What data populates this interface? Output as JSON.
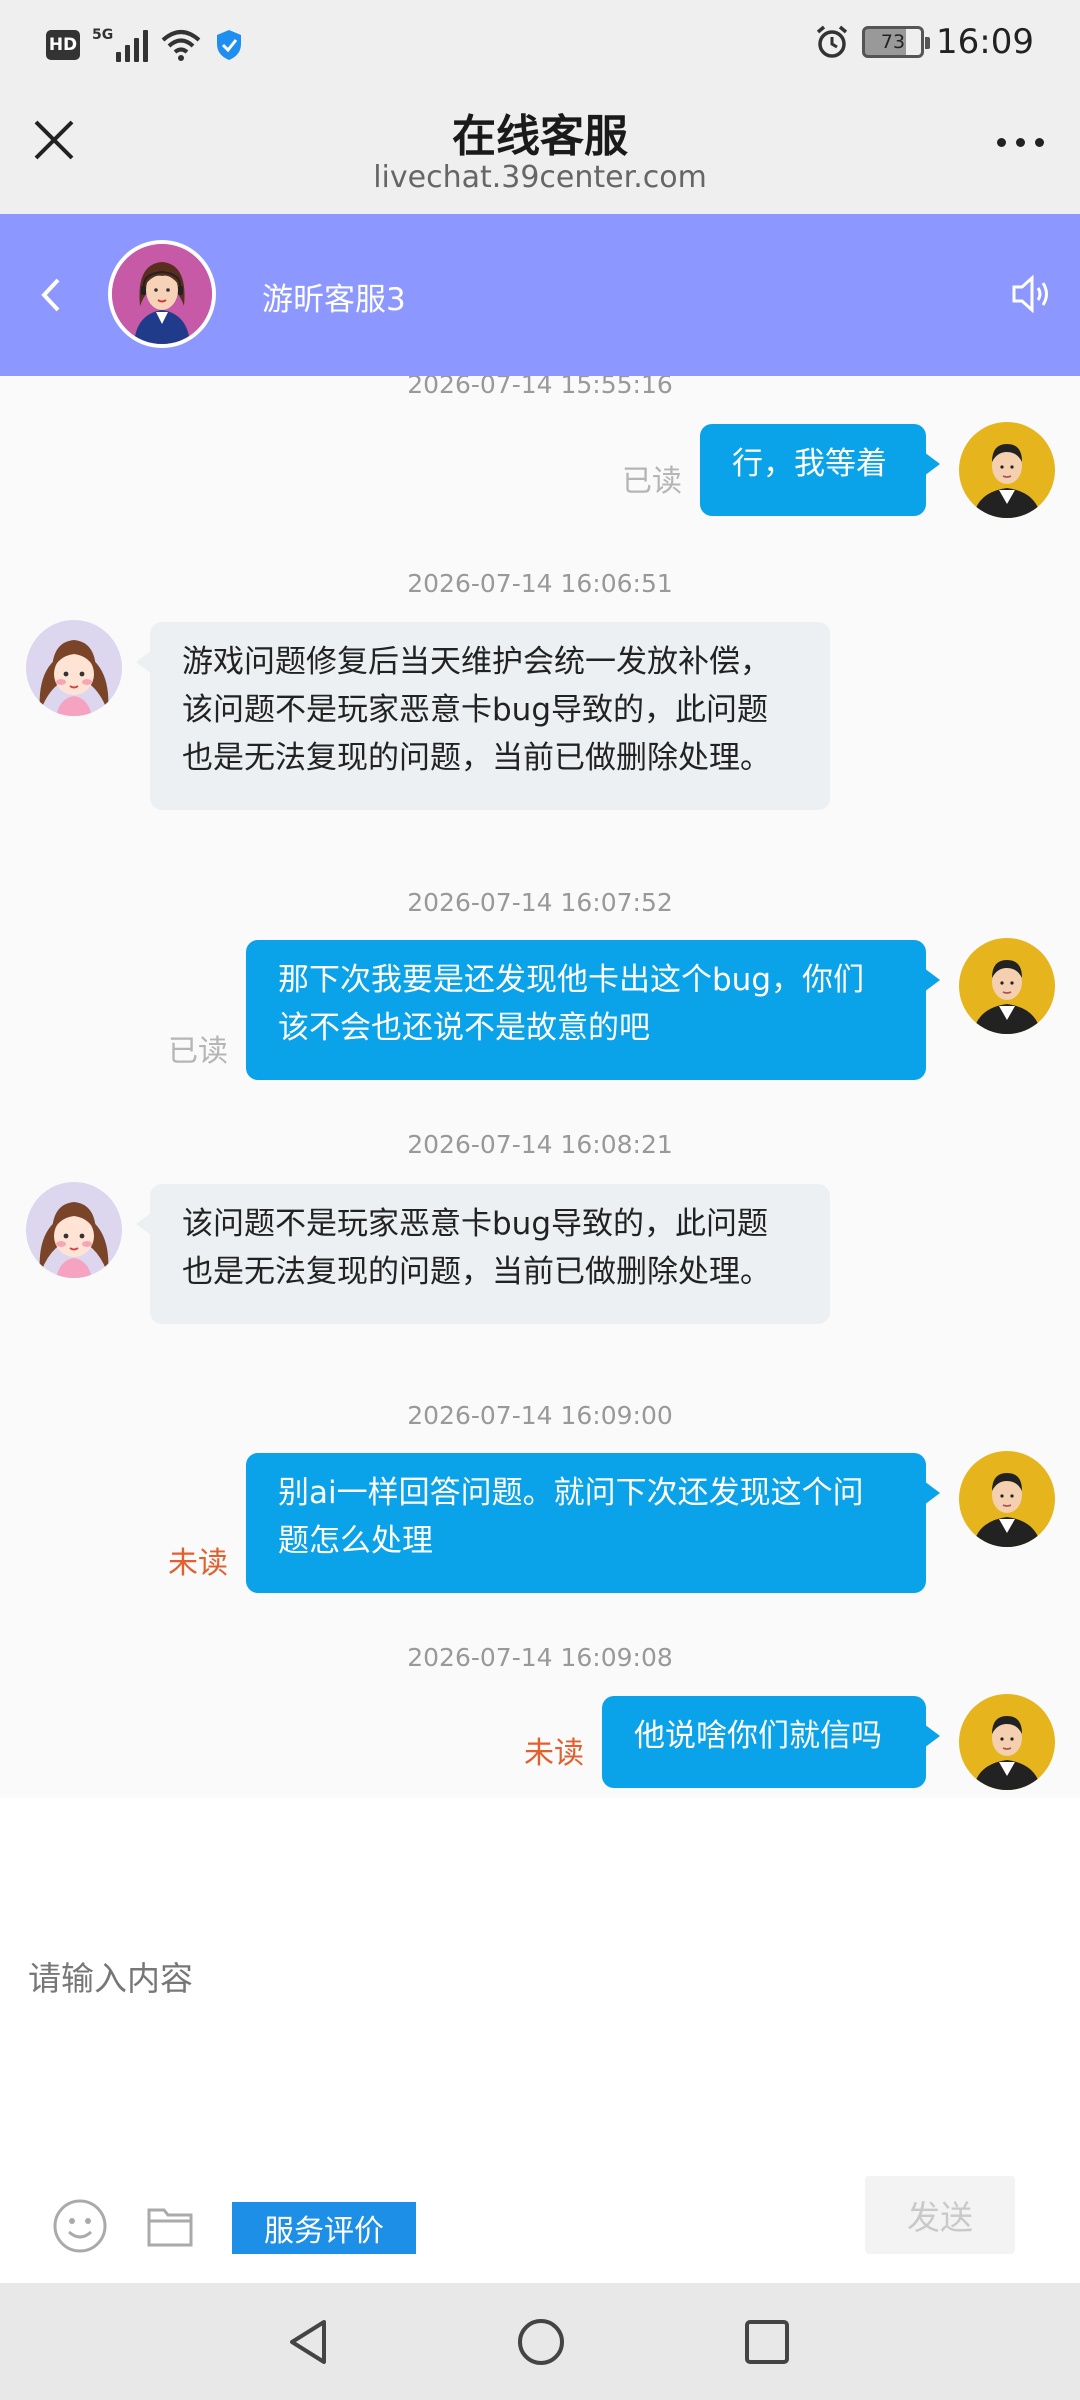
{
  "status_bar": {
    "hd": "HD",
    "network": "5G",
    "battery": "73",
    "time": "16:09"
  },
  "title_bar": {
    "title": "在线客服",
    "url": "livechat.39center.com"
  },
  "chat_header": {
    "agent_name": "游昕客服3",
    "header_color": "#8c97ff"
  },
  "messages": [
    {
      "type": "timestamp",
      "text": "2026-07-14 15:55:16"
    },
    {
      "type": "out",
      "text": "行，我等着",
      "status": "已读"
    },
    {
      "type": "timestamp",
      "text": "2026-07-14 16:06:51"
    },
    {
      "type": "in",
      "text": "游戏问题修复后当天维护会统一发放补偿，该问题不是玩家恶意卡bug导致的，此问题也是无法复现的问题，当前已做删除处理。"
    },
    {
      "type": "timestamp",
      "text": "2026-07-14 16:07:52"
    },
    {
      "type": "out",
      "text": "那下次我要是还发现他卡出这个bug，你们该不会也还说不是故意的吧",
      "status": "已读"
    },
    {
      "type": "timestamp",
      "text": "2026-07-14 16:08:21"
    },
    {
      "type": "in",
      "text": "该问题不是玩家恶意卡bug导致的，此问题也是无法复现的问题，当前已做删除处理。"
    },
    {
      "type": "timestamp",
      "text": "2026-07-14 16:09:00"
    },
    {
      "type": "out",
      "text": "别ai一样回答问题。就问下次还发现这个问题怎么处理",
      "status": "未读"
    },
    {
      "type": "timestamp",
      "text": "2026-07-14 16:09:08"
    },
    {
      "type": "out",
      "text": "他说啥你们就信吗",
      "status": "未读"
    }
  ],
  "input": {
    "placeholder": "请输入内容"
  },
  "toolbar": {
    "rate_label": "服务评价",
    "send_label": "发送"
  },
  "colors": {
    "outgoing_bubble": "#0aa2e8",
    "incoming_bubble": "#edf0f2",
    "unread": "#e2602d",
    "read": "#b5b5b5"
  }
}
